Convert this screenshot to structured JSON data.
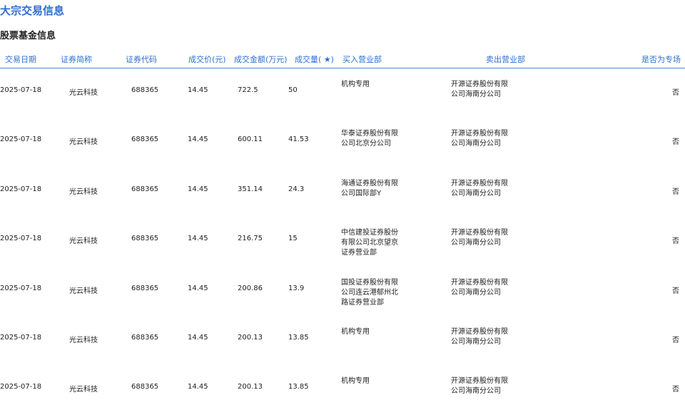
{
  "page": {
    "title": "大宗交易信息",
    "section_title": "股票基金信息"
  },
  "table": {
    "headers": {
      "date": "交易日期",
      "name": "证券简称",
      "code": "证券代码",
      "price": "成交价(元)",
      "amount": "成交金额(万元)",
      "volume": "成交量( ★)",
      "buy": "买入营业部",
      "sell": "卖出营业部",
      "flag": "是否为专场"
    },
    "rows": [
      {
        "date": "2025-07-18",
        "name": "光云科技",
        "code": "688365",
        "price": "14.45",
        "amount": "722.5",
        "volume": "50",
        "buy": "机构专用",
        "sell": "开源证券股份有限公司海南分公司",
        "flag": "否"
      },
      {
        "date": "2025-07-18",
        "name": "光云科技",
        "code": "688365",
        "price": "14.45",
        "amount": "600.11",
        "volume": "41.53",
        "buy": "华泰证券股份有限公司北京分公司",
        "sell": "开源证券股份有限公司海南分公司",
        "flag": "否"
      },
      {
        "date": "2025-07-18",
        "name": "光云科技",
        "code": "688365",
        "price": "14.45",
        "amount": "351.14",
        "volume": "24.3",
        "buy": "海通证券股份有限公司国际部Y",
        "sell": "开源证券股份有限公司海南分公司",
        "flag": "否"
      },
      {
        "date": "2025-07-18",
        "name": "光云科技",
        "code": "688365",
        "price": "14.45",
        "amount": "216.75",
        "volume": "15",
        "buy": "中信建投证券股份有限公司北京望京证券营业部",
        "sell": "开源证券股份有限公司海南分公司",
        "flag": "否"
      },
      {
        "date": "2025-07-18",
        "name": "光云科技",
        "code": "688365",
        "price": "14.45",
        "amount": "200.86",
        "volume": "13.9",
        "buy": "国投证券股份有限公司连云港郁州北路证券营业部",
        "sell": "开源证券股份有限公司海南分公司",
        "flag": "否"
      },
      {
        "date": "2025-07-18",
        "name": "光云科技",
        "code": "688365",
        "price": "14.45",
        "amount": "200.13",
        "volume": "13.85",
        "buy": "机构专用",
        "sell": "开源证券股份有限公司海南分公司",
        "flag": "否"
      },
      {
        "date": "2025-07-18",
        "name": "光云科技",
        "code": "688365",
        "price": "14.45",
        "amount": "200.13",
        "volume": "13.85",
        "buy": "机构专用",
        "sell": "开源证券股份有限公司海南分公司",
        "flag": "否"
      }
    ]
  }
}
